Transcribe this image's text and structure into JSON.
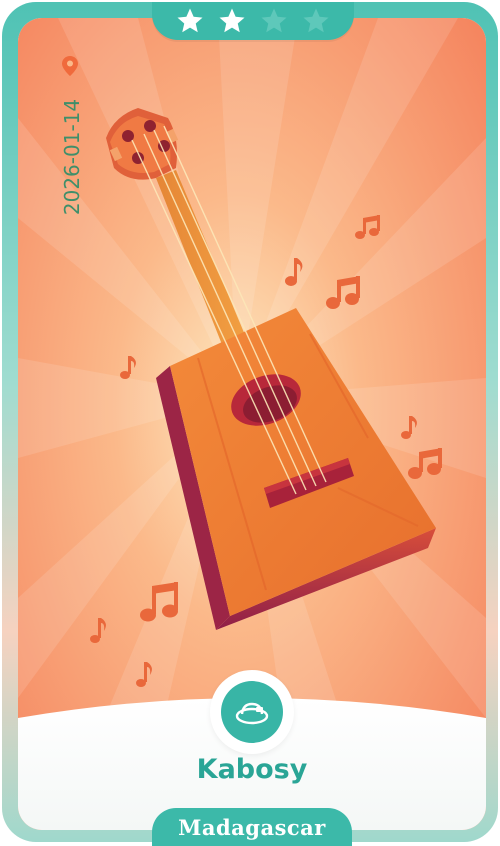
{
  "card": {
    "stars_filled": 2,
    "stars_total": 4,
    "date": "2026-01-14",
    "item_name": "Kabosy",
    "country": "Madagascar"
  },
  "colors": {
    "teal": "#3cb9a9",
    "teal_dark": "#2aa596",
    "date_green": "#3f8f6a",
    "background_orange": "#f58a5e",
    "background_light": "#fde0b8"
  },
  "icons": {
    "pin": "location-pin-icon",
    "badge": "hat-badge-icon",
    "star": "star-icon"
  }
}
